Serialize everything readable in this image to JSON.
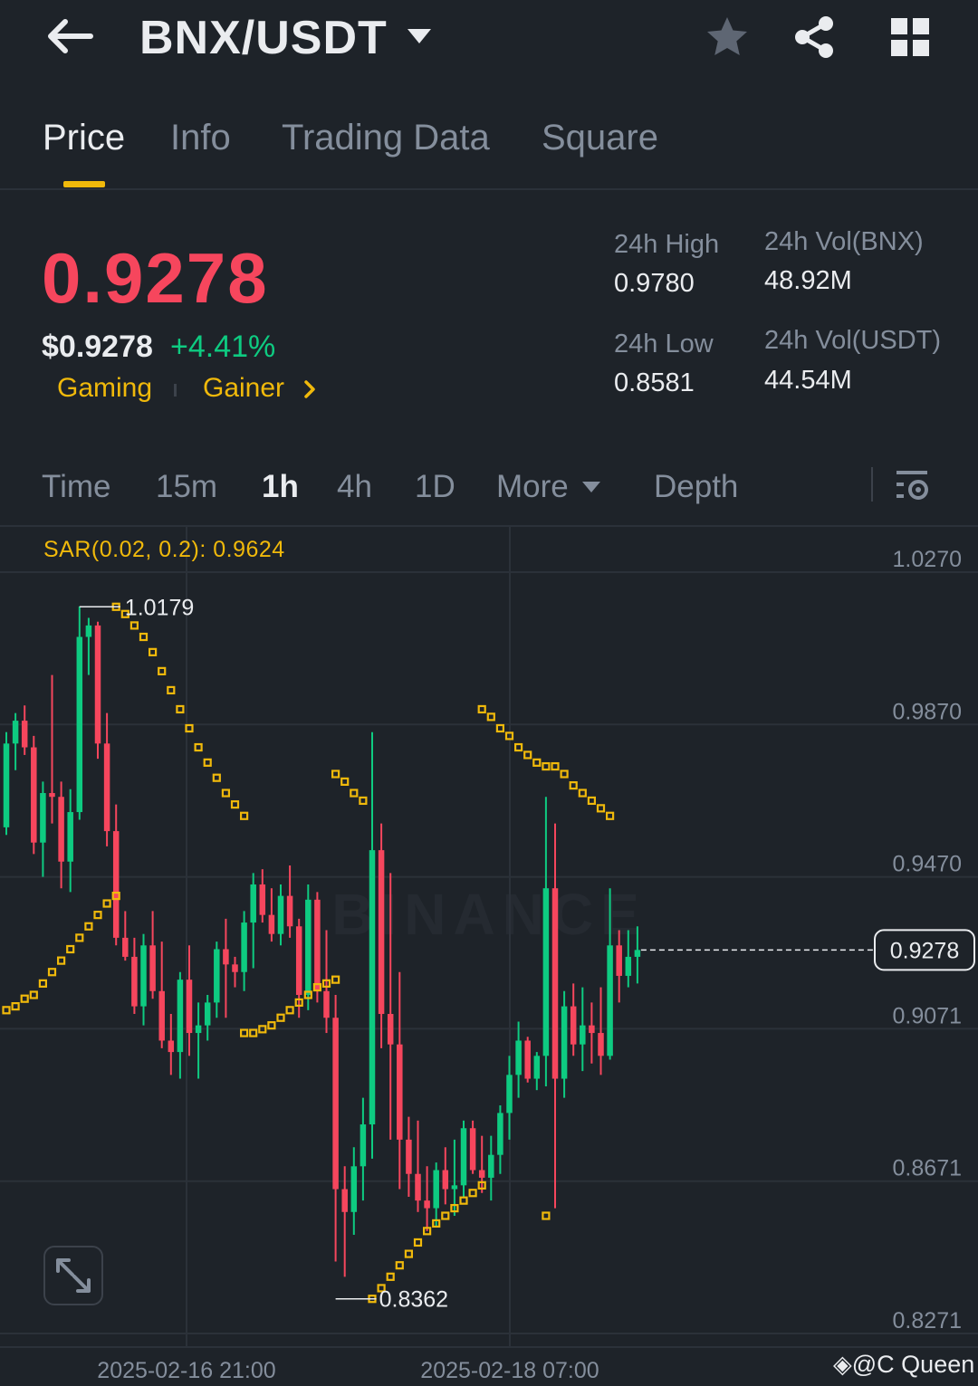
{
  "header": {
    "pair": "BNX/USDT",
    "icons": [
      "back-arrow-icon",
      "caret-down-icon",
      "star-icon",
      "share-icon",
      "grid-icon"
    ]
  },
  "tabs": [
    {
      "label": "Price",
      "active": true
    },
    {
      "label": "Info",
      "active": false
    },
    {
      "label": "Trading Data",
      "active": false
    },
    {
      "label": "Square",
      "active": false
    }
  ],
  "ticker": {
    "last_price": "0.9278",
    "usd_price": "$0.9278",
    "change_pct": "+4.41%",
    "tags": [
      "Gaming",
      "Gainer"
    ],
    "stats": {
      "high_label": "24h High",
      "high_value": "0.9780",
      "low_label": "24h Low",
      "low_value": "0.8581",
      "vol_base_label": "24h Vol(BNX)",
      "vol_base_value": "48.92M",
      "vol_quote_label": "24h Vol(USDT)",
      "vol_quote_value": "44.54M"
    }
  },
  "intervals": {
    "items": [
      "Time",
      "15m",
      "1h",
      "4h",
      "1D",
      "More",
      "Depth"
    ],
    "active": "1h"
  },
  "colors": {
    "background": "#1e2329",
    "up": "#0ecb81",
    "down": "#f6465d",
    "accent": "#f0b90b",
    "muted": "#848e9c"
  },
  "chart": {
    "indicator_label": "SAR(0.02, 0.2): 0.9624",
    "watermark": "BINANCE",
    "credit": "@C Queen"
  },
  "chart_data": {
    "type": "candlestick",
    "y_ticks": [
      "1.0270",
      "0.9870",
      "0.9470",
      "0.9071",
      "0.8671",
      "0.8271"
    ],
    "ylim": [
      0.8271,
      1.027
    ],
    "x_ticks": [
      "2025-02-16 21:00",
      "2025-02-18 07:00"
    ],
    "current_price": "0.9278",
    "max_label": "1.0179",
    "min_label": "0.8362",
    "candles": [
      [
        0.96,
        0.985,
        0.958,
        0.982
      ],
      [
        0.982,
        0.99,
        0.975,
        0.988
      ],
      [
        0.988,
        0.992,
        0.979,
        0.981
      ],
      [
        0.981,
        0.984,
        0.953,
        0.956
      ],
      [
        0.956,
        0.972,
        0.947,
        0.969
      ],
      [
        0.969,
        1.0,
        0.961,
        0.968
      ],
      [
        0.968,
        0.972,
        0.944,
        0.951
      ],
      [
        0.951,
        0.97,
        0.943,
        0.964
      ],
      [
        0.964,
        1.018,
        0.962,
        1.01
      ],
      [
        1.01,
        1.015,
        1.0,
        1.013
      ],
      [
        1.013,
        1.014,
        0.978,
        0.982
      ],
      [
        0.982,
        0.99,
        0.955,
        0.959
      ],
      [
        0.959,
        0.966,
        0.929,
        0.931
      ],
      [
        0.931,
        0.938,
        0.925,
        0.926
      ],
      [
        0.926,
        0.931,
        0.911,
        0.913
      ],
      [
        0.913,
        0.932,
        0.908,
        0.929
      ],
      [
        0.929,
        0.938,
        0.915,
        0.917
      ],
      [
        0.917,
        0.93,
        0.902,
        0.904
      ],
      [
        0.904,
        0.911,
        0.895,
        0.901
      ],
      [
        0.901,
        0.922,
        0.894,
        0.92
      ],
      [
        0.92,
        0.929,
        0.9,
        0.906
      ],
      [
        0.906,
        0.914,
        0.894,
        0.908
      ],
      [
        0.908,
        0.916,
        0.904,
        0.914
      ],
      [
        0.914,
        0.93,
        0.91,
        0.928
      ],
      [
        0.928,
        0.936,
        0.91,
        0.924
      ],
      [
        0.924,
        0.926,
        0.918,
        0.922
      ],
      [
        0.922,
        0.938,
        0.917,
        0.935
      ],
      [
        0.935,
        0.948,
        0.923,
        0.945
      ],
      [
        0.945,
        0.949,
        0.935,
        0.937
      ],
      [
        0.937,
        0.944,
        0.93,
        0.932
      ],
      [
        0.932,
        0.945,
        0.929,
        0.942
      ],
      [
        0.942,
        0.95,
        0.931,
        0.934
      ],
      [
        0.934,
        0.936,
        0.91,
        0.916
      ],
      [
        0.916,
        0.945,
        0.912,
        0.941
      ],
      [
        0.941,
        0.943,
        0.914,
        0.917
      ],
      [
        0.917,
        0.933,
        0.906,
        0.91
      ],
      [
        0.91,
        0.916,
        0.846,
        0.865
      ],
      [
        0.865,
        0.871,
        0.842,
        0.859
      ],
      [
        0.859,
        0.876,
        0.853,
        0.871
      ],
      [
        0.871,
        0.889,
        0.862,
        0.882
      ],
      [
        0.882,
        0.985,
        0.873,
        0.954
      ],
      [
        0.954,
        0.961,
        0.902,
        0.911
      ],
      [
        0.911,
        0.948,
        0.878,
        0.903
      ],
      [
        0.903,
        0.922,
        0.865,
        0.878
      ],
      [
        0.878,
        0.884,
        0.863,
        0.869
      ],
      [
        0.869,
        0.883,
        0.859,
        0.862
      ],
      [
        0.862,
        0.871,
        0.854,
        0.86
      ],
      [
        0.86,
        0.872,
        0.855,
        0.87
      ],
      [
        0.87,
        0.876,
        0.861,
        0.865
      ],
      [
        0.865,
        0.878,
        0.858,
        0.866
      ],
      [
        0.866,
        0.883,
        0.863,
        0.881
      ],
      [
        0.881,
        0.883,
        0.869,
        0.87
      ],
      [
        0.87,
        0.879,
        0.864,
        0.868
      ],
      [
        0.868,
        0.879,
        0.862,
        0.874
      ],
      [
        0.874,
        0.887,
        0.869,
        0.885
      ],
      [
        0.885,
        0.9,
        0.878,
        0.895
      ],
      [
        0.895,
        0.909,
        0.889,
        0.904
      ],
      [
        0.904,
        0.905,
        0.893,
        0.894
      ],
      [
        0.894,
        0.901,
        0.891,
        0.9
      ],
      [
        0.9,
        0.968,
        0.892,
        0.944
      ],
      [
        0.944,
        0.961,
        0.86,
        0.894
      ],
      [
        0.894,
        0.917,
        0.889,
        0.913
      ],
      [
        0.913,
        0.919,
        0.9,
        0.903
      ],
      [
        0.903,
        0.918,
        0.896,
        0.908
      ],
      [
        0.908,
        0.914,
        0.898,
        0.906
      ],
      [
        0.906,
        0.918,
        0.895,
        0.9
      ],
      [
        0.9,
        0.944,
        0.899,
        0.929
      ],
      [
        0.929,
        0.933,
        0.914,
        0.921
      ],
      [
        0.921,
        0.933,
        0.918,
        0.926
      ],
      [
        0.926,
        0.934,
        0.919,
        0.9278
      ]
    ],
    "sar": [
      [
        0,
        0.912
      ],
      [
        1,
        0.913
      ],
      [
        2,
        0.915
      ],
      [
        3,
        0.916
      ],
      [
        4,
        0.919
      ],
      [
        5,
        0.922
      ],
      [
        6,
        0.925
      ],
      [
        7,
        0.928
      ],
      [
        8,
        0.931
      ],
      [
        9,
        0.934
      ],
      [
        10,
        0.937
      ],
      [
        11,
        0.94
      ],
      [
        12,
        0.942
      ],
      [
        12,
        1.0179
      ],
      [
        13,
        1.016
      ],
      [
        14,
        1.013
      ],
      [
        15,
        1.01
      ],
      [
        16,
        1.006
      ],
      [
        17,
        1.001
      ],
      [
        18,
        0.996
      ],
      [
        19,
        0.991
      ],
      [
        20,
        0.986
      ],
      [
        21,
        0.981
      ],
      [
        22,
        0.977
      ],
      [
        23,
        0.973
      ],
      [
        24,
        0.969
      ],
      [
        25,
        0.966
      ],
      [
        26,
        0.963
      ],
      [
        26,
        0.906
      ],
      [
        27,
        0.906
      ],
      [
        28,
        0.907
      ],
      [
        29,
        0.908
      ],
      [
        30,
        0.91
      ],
      [
        31,
        0.912
      ],
      [
        32,
        0.914
      ],
      [
        33,
        0.916
      ],
      [
        34,
        0.918
      ],
      [
        35,
        0.919
      ],
      [
        36,
        0.92
      ],
      [
        36,
        0.974
      ],
      [
        37,
        0.972
      ],
      [
        38,
        0.969
      ],
      [
        39,
        0.967
      ],
      [
        40,
        0.8362
      ],
      [
        41,
        0.839
      ],
      [
        42,
        0.842
      ],
      [
        43,
        0.845
      ],
      [
        44,
        0.848
      ],
      [
        45,
        0.851
      ],
      [
        46,
        0.854
      ],
      [
        47,
        0.856
      ],
      [
        48,
        0.858
      ],
      [
        49,
        0.86
      ],
      [
        50,
        0.862
      ],
      [
        51,
        0.864
      ],
      [
        52,
        0.866
      ],
      [
        52,
        0.991
      ],
      [
        53,
        0.989
      ],
      [
        54,
        0.986
      ],
      [
        55,
        0.984
      ],
      [
        56,
        0.981
      ],
      [
        57,
        0.979
      ],
      [
        58,
        0.977
      ],
      [
        59,
        0.976
      ],
      [
        60,
        0.976
      ],
      [
        61,
        0.974
      ],
      [
        62,
        0.971
      ],
      [
        63,
        0.969
      ],
      [
        64,
        0.967
      ],
      [
        65,
        0.965
      ],
      [
        66,
        0.963
      ],
      [
        59,
        0.858
      ]
    ]
  }
}
